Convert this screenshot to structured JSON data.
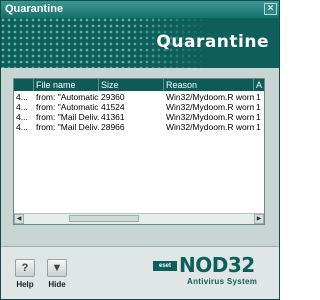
{
  "window": {
    "title": "Quarantine",
    "close_label": "×"
  },
  "banner": {
    "title": "Quarantine"
  },
  "list": {
    "columns": [
      "",
      "File name",
      "Size",
      "Reason",
      "A"
    ],
    "rows": [
      [
        "4...",
        "from: \"Automatic...",
        "29360",
        "Win32/Mydoom.R worm",
        "1"
      ],
      [
        "4...",
        "from: \"Automatic...",
        "41524",
        "Win32/Mydoom.R worm",
        "1"
      ],
      [
        "4...",
        "from: \"Mail Deliv...",
        "41361",
        "Win32/Mydoom.R worm",
        "1"
      ],
      [
        "4...",
        "from: \"Mail Deliv...",
        "28966",
        "Win32/Mydoom.R worm",
        "1"
      ]
    ]
  },
  "footer": {
    "help_label": "Help",
    "help_icon": "?",
    "hide_label": "Hide",
    "hide_icon": "▼"
  },
  "logo": {
    "eset": "eset",
    "product": "NOD32",
    "subtitle": "Antivirus System"
  },
  "colors": {
    "accent": "#0e5f5b",
    "title": "#16706b",
    "content_bg": "#c9d5d3"
  }
}
